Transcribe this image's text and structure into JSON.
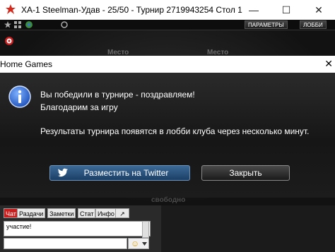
{
  "window": {
    "title": "XA-1 Steelman-Удав - 25/50 - Турнир 2719943254 Стол 1",
    "minimize": "—",
    "maximize": "☐",
    "close": "✕"
  },
  "toolbar": {
    "settings_label": "ПАРАМЕТРЫ",
    "lobby_label": "ЛОББИ"
  },
  "table": {
    "seat_left": "Место",
    "seat_right": "Место",
    "seat_free": "свободно"
  },
  "dialog": {
    "title": "Home Games",
    "line1": "Вы победили в турнире - поздравляем!",
    "line2": "Благодарим за игру",
    "line3": "Результаты турнира появятся в лобби клуба через несколько минут.",
    "twitter_button": "Разместить на Twitter",
    "close_button": "Закрыть",
    "close_x": "✕"
  },
  "chat": {
    "tabs": [
      "Чат",
      "Раздачи",
      "Заметки",
      "Стат",
      "Инфо",
      "↗"
    ],
    "log_line": "участие!",
    "emoji": "☺"
  },
  "colors": {
    "accent_red": "#c81e1e",
    "twitter_blue": "#2a5580"
  }
}
